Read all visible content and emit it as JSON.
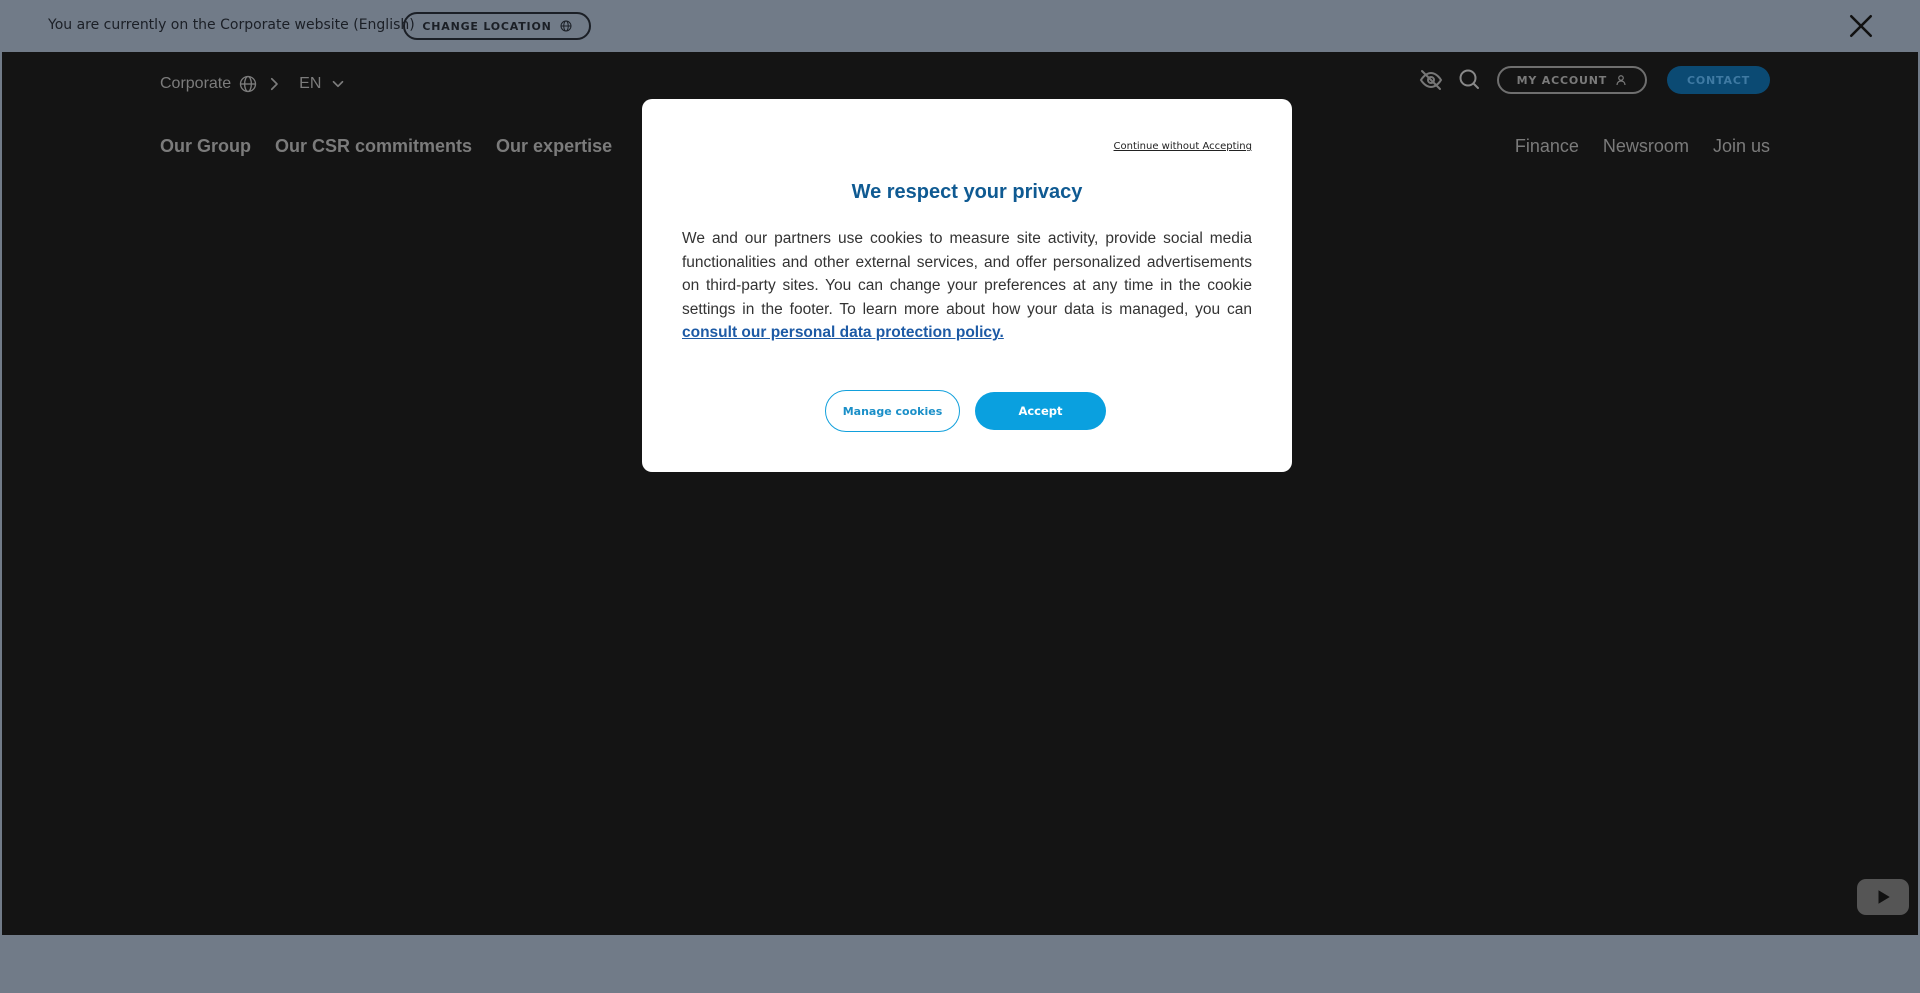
{
  "banner": {
    "text": "You are currently on the Corporate website (English)",
    "change_location_label": "CHANGE LOCATION"
  },
  "header": {
    "site_label": "Corporate",
    "language": "EN",
    "my_account_label": "MY ACCOUNT",
    "contact_label": "CONTACT"
  },
  "nav": {
    "left": [
      "Our Group",
      "Our CSR commitments",
      "Our expertise"
    ],
    "right": [
      "Finance",
      "Newsroom",
      "Join us"
    ]
  },
  "cookie_modal": {
    "skip_label": "Continue without Accepting",
    "title": "We respect your privacy",
    "body": "We and our partners use cookies to measure site activity, provide social media functionalities and other external services, and offer personalized advertisements on third-party sites. You can change your preferences at any time in the cookie settings in the footer. To learn more about how your data is managed, you can",
    "policy_link": "consult our personal data protection policy.",
    "manage_label": "Manage cookies",
    "accept_label": "Accept"
  },
  "colors": {
    "overlay": "#717b88",
    "site_bg": "#141414",
    "title_blue": "#0f5a92",
    "accept_blue": "#0aa0df"
  },
  "icons": [
    "globe-icon",
    "close-icon",
    "chevron-right-icon",
    "chevron-down-icon",
    "eye-off-icon",
    "search-icon",
    "user-icon",
    "youtube-play-icon"
  ]
}
